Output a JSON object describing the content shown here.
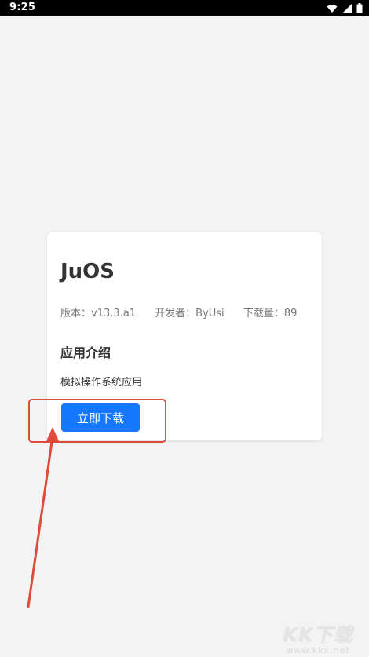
{
  "status_bar": {
    "time": "9:25",
    "icons": [
      "wifi-icon",
      "signal-icon",
      "battery-icon"
    ]
  },
  "app": {
    "title": "JuOS",
    "meta": {
      "version": "版本：v13.3.a1",
      "developer": "开发者：ByUsi",
      "downloads": "下载量：89"
    },
    "intro_title": "应用介绍",
    "intro_text": "模拟操作系统应用",
    "download_label": "立即下载"
  },
  "annotation": {
    "color": "#e04a3a"
  },
  "watermark": {
    "logo": "KK下载",
    "url": "www.kkx.net"
  },
  "colors": {
    "accent": "#1677ff",
    "background": "#f3f3f3",
    "card": "#ffffff"
  }
}
